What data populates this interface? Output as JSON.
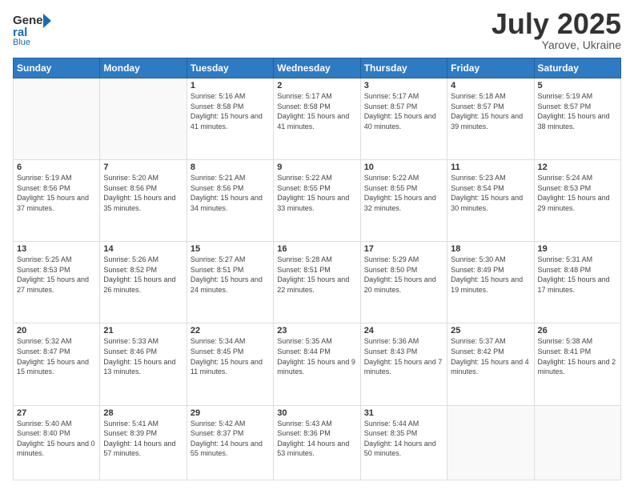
{
  "header": {
    "logo_general": "General",
    "logo_blue": "Blue",
    "month": "July 2025",
    "location": "Yarove, Ukraine"
  },
  "weekdays": [
    "Sunday",
    "Monday",
    "Tuesday",
    "Wednesday",
    "Thursday",
    "Friday",
    "Saturday"
  ],
  "weeks": [
    [
      {
        "day": "",
        "info": ""
      },
      {
        "day": "",
        "info": ""
      },
      {
        "day": "1",
        "info": "Sunrise: 5:16 AM\nSunset: 8:58 PM\nDaylight: 15 hours and 41 minutes."
      },
      {
        "day": "2",
        "info": "Sunrise: 5:17 AM\nSunset: 8:58 PM\nDaylight: 15 hours and 41 minutes."
      },
      {
        "day": "3",
        "info": "Sunrise: 5:17 AM\nSunset: 8:57 PM\nDaylight: 15 hours and 40 minutes."
      },
      {
        "day": "4",
        "info": "Sunrise: 5:18 AM\nSunset: 8:57 PM\nDaylight: 15 hours and 39 minutes."
      },
      {
        "day": "5",
        "info": "Sunrise: 5:19 AM\nSunset: 8:57 PM\nDaylight: 15 hours and 38 minutes."
      }
    ],
    [
      {
        "day": "6",
        "info": "Sunrise: 5:19 AM\nSunset: 8:56 PM\nDaylight: 15 hours and 37 minutes."
      },
      {
        "day": "7",
        "info": "Sunrise: 5:20 AM\nSunset: 8:56 PM\nDaylight: 15 hours and 35 minutes."
      },
      {
        "day": "8",
        "info": "Sunrise: 5:21 AM\nSunset: 8:56 PM\nDaylight: 15 hours and 34 minutes."
      },
      {
        "day": "9",
        "info": "Sunrise: 5:22 AM\nSunset: 8:55 PM\nDaylight: 15 hours and 33 minutes."
      },
      {
        "day": "10",
        "info": "Sunrise: 5:22 AM\nSunset: 8:55 PM\nDaylight: 15 hours and 32 minutes."
      },
      {
        "day": "11",
        "info": "Sunrise: 5:23 AM\nSunset: 8:54 PM\nDaylight: 15 hours and 30 minutes."
      },
      {
        "day": "12",
        "info": "Sunrise: 5:24 AM\nSunset: 8:53 PM\nDaylight: 15 hours and 29 minutes."
      }
    ],
    [
      {
        "day": "13",
        "info": "Sunrise: 5:25 AM\nSunset: 8:53 PM\nDaylight: 15 hours and 27 minutes."
      },
      {
        "day": "14",
        "info": "Sunrise: 5:26 AM\nSunset: 8:52 PM\nDaylight: 15 hours and 26 minutes."
      },
      {
        "day": "15",
        "info": "Sunrise: 5:27 AM\nSunset: 8:51 PM\nDaylight: 15 hours and 24 minutes."
      },
      {
        "day": "16",
        "info": "Sunrise: 5:28 AM\nSunset: 8:51 PM\nDaylight: 15 hours and 22 minutes."
      },
      {
        "day": "17",
        "info": "Sunrise: 5:29 AM\nSunset: 8:50 PM\nDaylight: 15 hours and 20 minutes."
      },
      {
        "day": "18",
        "info": "Sunrise: 5:30 AM\nSunset: 8:49 PM\nDaylight: 15 hours and 19 minutes."
      },
      {
        "day": "19",
        "info": "Sunrise: 5:31 AM\nSunset: 8:48 PM\nDaylight: 15 hours and 17 minutes."
      }
    ],
    [
      {
        "day": "20",
        "info": "Sunrise: 5:32 AM\nSunset: 8:47 PM\nDaylight: 15 hours and 15 minutes."
      },
      {
        "day": "21",
        "info": "Sunrise: 5:33 AM\nSunset: 8:46 PM\nDaylight: 15 hours and 13 minutes."
      },
      {
        "day": "22",
        "info": "Sunrise: 5:34 AM\nSunset: 8:45 PM\nDaylight: 15 hours and 11 minutes."
      },
      {
        "day": "23",
        "info": "Sunrise: 5:35 AM\nSunset: 8:44 PM\nDaylight: 15 hours and 9 minutes."
      },
      {
        "day": "24",
        "info": "Sunrise: 5:36 AM\nSunset: 8:43 PM\nDaylight: 15 hours and 7 minutes."
      },
      {
        "day": "25",
        "info": "Sunrise: 5:37 AM\nSunset: 8:42 PM\nDaylight: 15 hours and 4 minutes."
      },
      {
        "day": "26",
        "info": "Sunrise: 5:38 AM\nSunset: 8:41 PM\nDaylight: 15 hours and 2 minutes."
      }
    ],
    [
      {
        "day": "27",
        "info": "Sunrise: 5:40 AM\nSunset: 8:40 PM\nDaylight: 15 hours and 0 minutes."
      },
      {
        "day": "28",
        "info": "Sunrise: 5:41 AM\nSunset: 8:39 PM\nDaylight: 14 hours and 57 minutes."
      },
      {
        "day": "29",
        "info": "Sunrise: 5:42 AM\nSunset: 8:37 PM\nDaylight: 14 hours and 55 minutes."
      },
      {
        "day": "30",
        "info": "Sunrise: 5:43 AM\nSunset: 8:36 PM\nDaylight: 14 hours and 53 minutes."
      },
      {
        "day": "31",
        "info": "Sunrise: 5:44 AM\nSunset: 8:35 PM\nDaylight: 14 hours and 50 minutes."
      },
      {
        "day": "",
        "info": ""
      },
      {
        "day": "",
        "info": ""
      }
    ]
  ]
}
